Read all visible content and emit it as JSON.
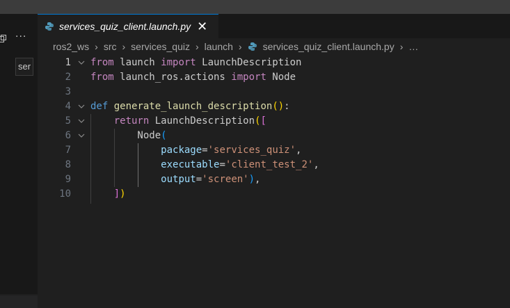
{
  "sidebar": {
    "more_label": "···",
    "input_value": "ser"
  },
  "tab": {
    "label": "services_quiz_client.launch.py",
    "close": "✕"
  },
  "breadcrumb": {
    "items": [
      "ros2_ws",
      "src",
      "services_quiz",
      "launch",
      "services_quiz_client.launch.py",
      "…"
    ],
    "separator": "›"
  },
  "editor": {
    "active_line": 1,
    "lines": [
      {
        "n": "1",
        "tokens": [
          [
            "kw",
            "from"
          ],
          [
            "plain",
            " launch "
          ],
          [
            "kw",
            "import"
          ],
          [
            "plain",
            " LaunchDescription"
          ]
        ]
      },
      {
        "n": "2",
        "tokens": [
          [
            "kw",
            "from"
          ],
          [
            "plain",
            " launch_ros.actions "
          ],
          [
            "kw",
            "import"
          ],
          [
            "plain",
            " Node"
          ]
        ]
      },
      {
        "n": "3",
        "tokens": []
      },
      {
        "n": "4",
        "tokens": [
          [
            "kw2",
            "def"
          ],
          [
            "plain",
            " "
          ],
          [
            "fn",
            "generate_launch_description"
          ],
          [
            "br1",
            "()"
          ],
          [
            "plain",
            ":"
          ]
        ]
      },
      {
        "n": "5",
        "tokens": [
          [
            "plain",
            "    "
          ],
          [
            "kw",
            "return"
          ],
          [
            "plain",
            " LaunchDescription"
          ],
          [
            "br1",
            "("
          ],
          [
            "br2",
            "["
          ]
        ]
      },
      {
        "n": "6",
        "tokens": [
          [
            "plain",
            "        Node"
          ],
          [
            "br3",
            "("
          ]
        ]
      },
      {
        "n": "7",
        "tokens": [
          [
            "plain",
            "            "
          ],
          [
            "param",
            "package"
          ],
          [
            "plain",
            "="
          ],
          [
            "str",
            "'services_quiz'"
          ],
          [
            "plain",
            ","
          ]
        ]
      },
      {
        "n": "8",
        "tokens": [
          [
            "plain",
            "            "
          ],
          [
            "param",
            "executable"
          ],
          [
            "plain",
            "="
          ],
          [
            "str",
            "'client_test_2'"
          ],
          [
            "plain",
            ","
          ]
        ]
      },
      {
        "n": "9",
        "tokens": [
          [
            "plain",
            "            "
          ],
          [
            "param",
            "output"
          ],
          [
            "plain",
            "="
          ],
          [
            "str",
            "'screen'"
          ],
          [
            "br3",
            ")"
          ],
          [
            "plain",
            ","
          ]
        ]
      },
      {
        "n": "10",
        "tokens": [
          [
            "plain",
            "    "
          ],
          [
            "br2",
            "]"
          ],
          [
            "br1",
            ")"
          ]
        ]
      }
    ],
    "fold_lines": [
      "1",
      "4",
      "5",
      "6"
    ]
  },
  "colors": {
    "background": "#1f1f1f",
    "keyword": "#c586c0",
    "def_keyword": "#569cd6",
    "function": "#dcdcaa",
    "string": "#ce9178",
    "parameter": "#9cdcfe",
    "tab_accent": "#0078d4"
  }
}
